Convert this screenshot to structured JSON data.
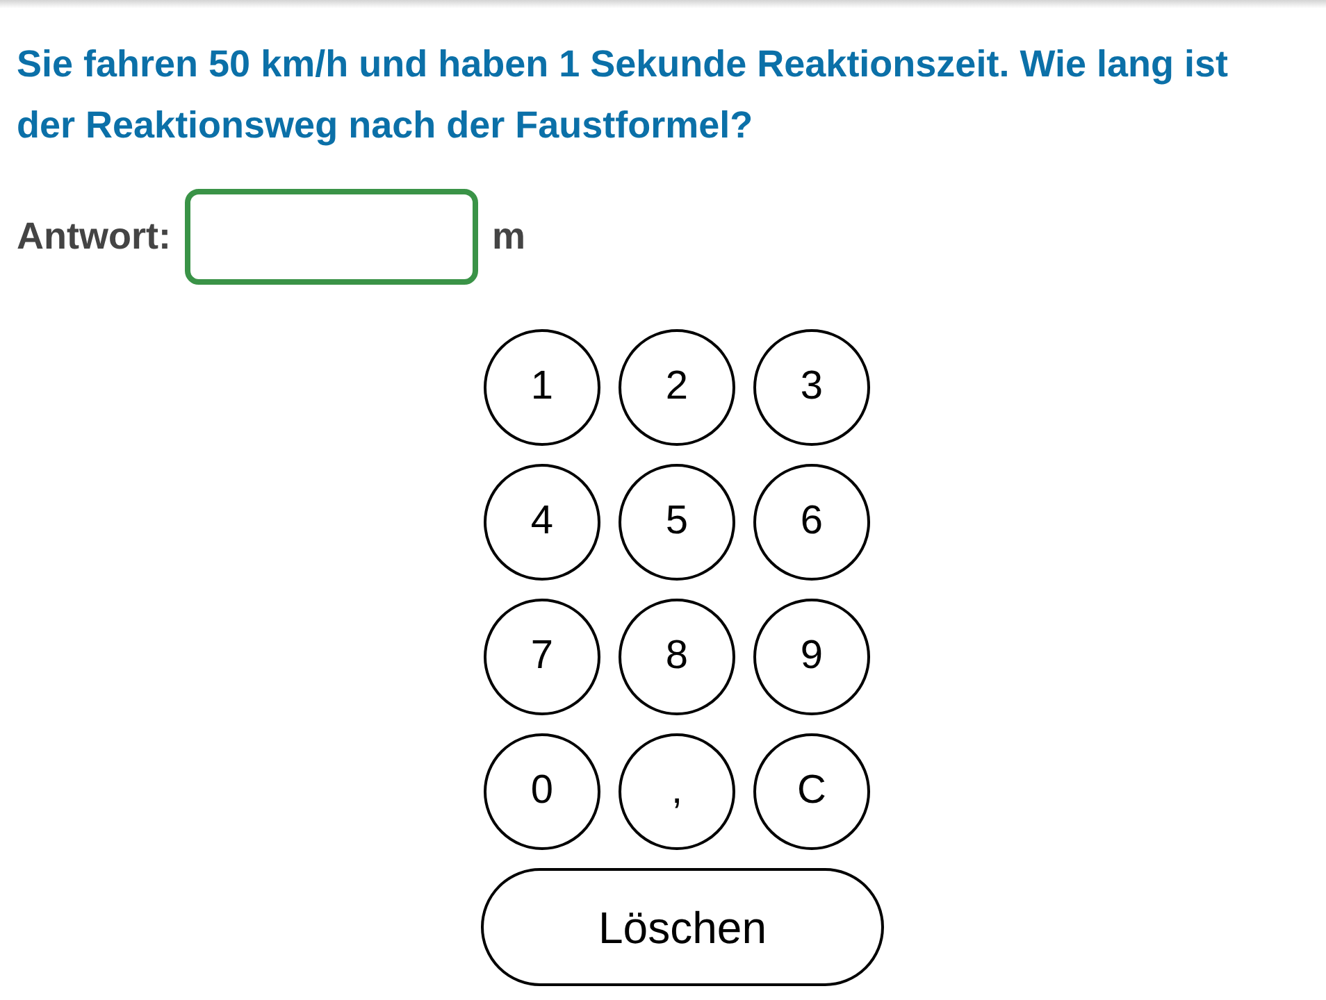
{
  "question": "Sie fahren 50 km/h und haben 1 Sekunde Reaktionszeit. Wie lang ist der Reaktionsweg nach der Faustformel?",
  "answer": {
    "label": "Antwort:",
    "unit": "m"
  },
  "keypad": {
    "keys": [
      "1",
      "2",
      "3",
      "4",
      "5",
      "6",
      "7",
      "8",
      "9",
      "0",
      ",",
      "C"
    ]
  },
  "delete_button": "Löschen"
}
